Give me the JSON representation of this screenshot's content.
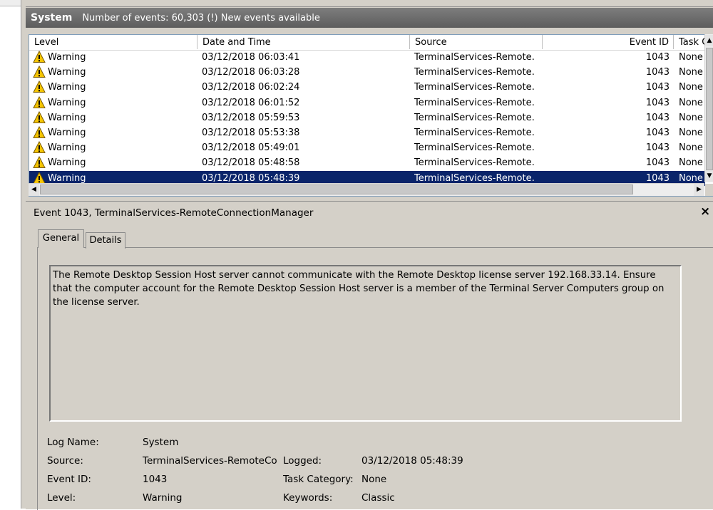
{
  "header": {
    "title": "System",
    "info": "Number of events: 60,303 (!) New events available"
  },
  "columns": {
    "level": "Level",
    "date": "Date and Time",
    "source": "Source",
    "event_id": "Event ID",
    "task": "Task C"
  },
  "events": [
    {
      "level": "Warning",
      "date": "03/12/2018 06:03:41",
      "source": "TerminalServices-Remote…",
      "event_id": "1043",
      "task": "None"
    },
    {
      "level": "Warning",
      "date": "03/12/2018 06:03:28",
      "source": "TerminalServices-Remote…",
      "event_id": "1043",
      "task": "None"
    },
    {
      "level": "Warning",
      "date": "03/12/2018 06:02:24",
      "source": "TerminalServices-Remote…",
      "event_id": "1043",
      "task": "None"
    },
    {
      "level": "Warning",
      "date": "03/12/2018 06:01:52",
      "source": "TerminalServices-Remote…",
      "event_id": "1043",
      "task": "None"
    },
    {
      "level": "Warning",
      "date": "03/12/2018 05:59:53",
      "source": "TerminalServices-Remote…",
      "event_id": "1043",
      "task": "None"
    },
    {
      "level": "Warning",
      "date": "03/12/2018 05:53:38",
      "source": "TerminalServices-Remote…",
      "event_id": "1043",
      "task": "None"
    },
    {
      "level": "Warning",
      "date": "03/12/2018 05:49:01",
      "source": "TerminalServices-Remote…",
      "event_id": "1043",
      "task": "None"
    },
    {
      "level": "Warning",
      "date": "03/12/2018 05:48:58",
      "source": "TerminalServices-Remote…",
      "event_id": "1043",
      "task": "None"
    },
    {
      "level": "Warning",
      "date": "03/12/2018 05:48:39",
      "source": "TerminalServices-Remote…",
      "event_id": "1043",
      "task": "None"
    }
  ],
  "selected_index": 8,
  "details": {
    "title": "Event 1043, TerminalServices-RemoteConnectionManager",
    "close_glyph": "×",
    "tab_general": "General",
    "tab_details": "Details",
    "message": "The Remote Desktop Session Host server cannot communicate with the Remote Desktop license server 192.168.33.14. Ensure that the computer account for the Remote Desktop Session Host server is a member of the Terminal Server Computers group on the license server.",
    "fields": {
      "log_name_label": "Log Name:",
      "log_name_value": "System",
      "source_label": "Source:",
      "source_value": "TerminalServices-RemoteCo",
      "logged_label": "Logged:",
      "logged_value": "03/12/2018 05:48:39",
      "event_id_label": "Event ID:",
      "event_id_value": "1043",
      "task_category_label": "Task Category:",
      "task_category_value": "None",
      "level_label": "Level:",
      "level_value": "Warning",
      "keywords_label": "Keywords:",
      "keywords_value": "Classic"
    }
  },
  "icons": {
    "row_level_icon": "warning-triangle-icon",
    "close": "close-icon"
  },
  "colors": {
    "selection": "#0a246a",
    "header_bar": "#6a6a6a",
    "warning_fill": "#f5c400"
  }
}
